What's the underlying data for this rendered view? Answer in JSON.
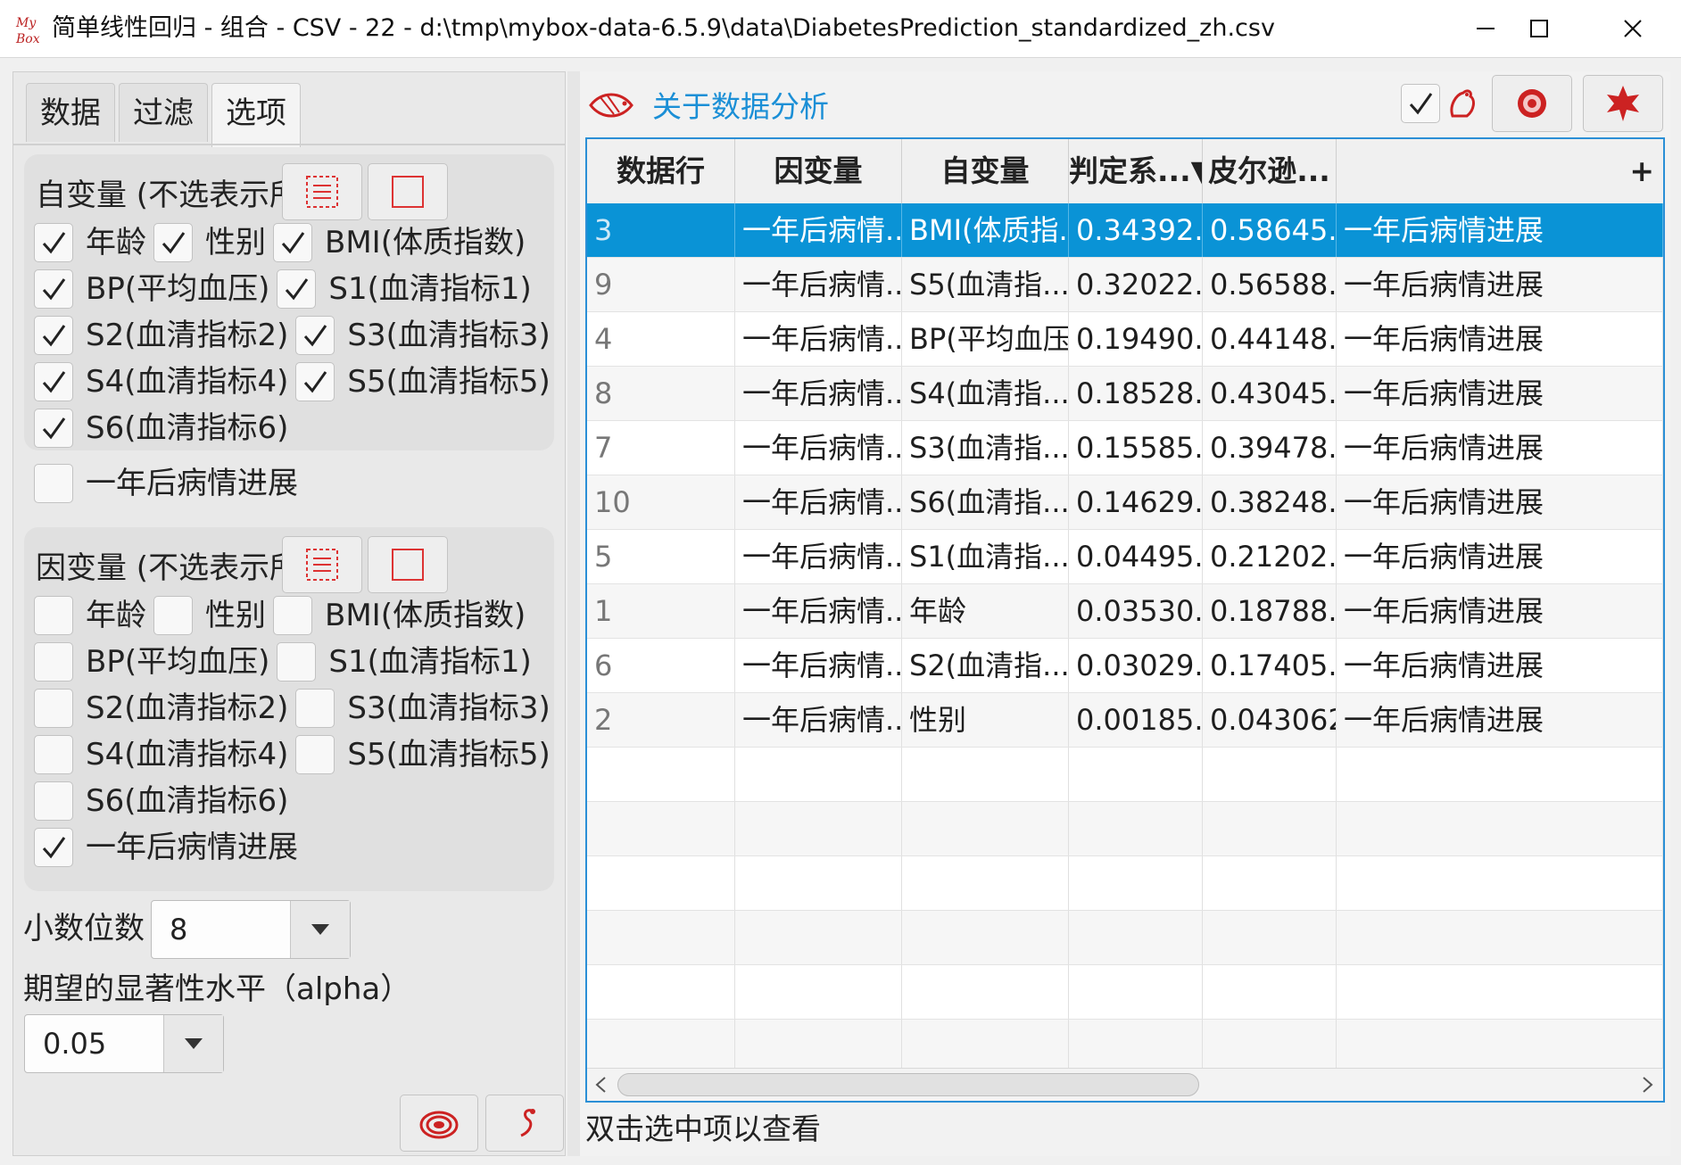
{
  "window": {
    "title": "简单线性回归 - 组合 - CSV - 22 - d:\\tmp\\mybox-data-6.5.9\\data\\DiabetesPrediction_standardized_zh.csv",
    "logo_text": "My Box",
    "accent": "#0a93d6"
  },
  "tabs": [
    "数据",
    "过滤",
    "选项"
  ],
  "independent": {
    "title": "自变量 (不选表示所有)",
    "items": [
      {
        "label": "年龄",
        "checked": true
      },
      {
        "label": "性别",
        "checked": true
      },
      {
        "label": "BMI(体质指数)",
        "checked": true
      },
      {
        "label": "BP(平均血压)",
        "checked": true
      },
      {
        "label": "S1(血清指标1)",
        "checked": true
      },
      {
        "label": "S2(血清指标2)",
        "checked": true
      },
      {
        "label": "S3(血清指标3)",
        "checked": true
      },
      {
        "label": "S4(血清指标4)",
        "checked": true
      },
      {
        "label": "S5(血清指标5)",
        "checked": true
      },
      {
        "label": "S6(血清指标6)",
        "checked": true
      },
      {
        "label": "一年后病情进展",
        "checked": false
      }
    ]
  },
  "dependent": {
    "title": "因变量 (不选表示所有)",
    "items": [
      {
        "label": "年龄",
        "checked": false
      },
      {
        "label": "性别",
        "checked": false
      },
      {
        "label": "BMI(体质指数)",
        "checked": false
      },
      {
        "label": "BP(平均血压)",
        "checked": false
      },
      {
        "label": "S1(血清指标1)",
        "checked": false
      },
      {
        "label": "S2(血清指标2)",
        "checked": false
      },
      {
        "label": "S3(血清指标3)",
        "checked": false
      },
      {
        "label": "S4(血清指标4)",
        "checked": false
      },
      {
        "label": "S5(血清指标5)",
        "checked": false
      },
      {
        "label": "S6(血清指标6)",
        "checked": false
      },
      {
        "label": "一年后病情进展",
        "checked": true
      }
    ]
  },
  "decimals": {
    "label": "小数位数",
    "value": "8"
  },
  "alpha": {
    "label": "期望的显著性水平（alpha）",
    "value": "0.05"
  },
  "right": {
    "title": "关于数据分析",
    "hint": "双击选中项以查看"
  },
  "table": {
    "columns": [
      "数据行",
      "因变量",
      "自变量",
      "判定系...▼",
      "皮尔逊...",
      "+"
    ],
    "rows": [
      [
        "3",
        "一年后病情...",
        "BMI(体质指...",
        "0.34392...",
        "0.58645...",
        "一年后病情进展"
      ],
      [
        "9",
        "一年后病情...",
        "S5(血清指...",
        "0.32022...",
        "0.56588...",
        "一年后病情进展"
      ],
      [
        "4",
        "一年后病情...",
        "BP(平均血压)",
        "0.19490...",
        "0.44148...",
        "一年后病情进展"
      ],
      [
        "8",
        "一年后病情...",
        "S4(血清指...",
        "0.18528...",
        "0.43045...",
        "一年后病情进展"
      ],
      [
        "7",
        "一年后病情...",
        "S3(血清指...",
        "0.15585...",
        "0.39478...",
        "一年后病情进展"
      ],
      [
        "10",
        "一年后病情...",
        "S6(血清指...",
        "0.14629...",
        "0.38248...",
        "一年后病情进展"
      ],
      [
        "5",
        "一年后病情...",
        "S1(血清指...",
        "0.04495...",
        "0.21202...",
        "一年后病情进展"
      ],
      [
        "1",
        "一年后病情...",
        "年龄",
        "0.03530...",
        "0.18788...",
        "一年后病情进展"
      ],
      [
        "6",
        "一年后病情...",
        "S2(血清指...",
        "0.03029...",
        "0.17405...",
        "一年后病情进展"
      ],
      [
        "2",
        "一年后病情...",
        "性别",
        "0.00185...",
        "0.043062",
        "一年后病情进展"
      ]
    ],
    "selected_row": 0
  }
}
